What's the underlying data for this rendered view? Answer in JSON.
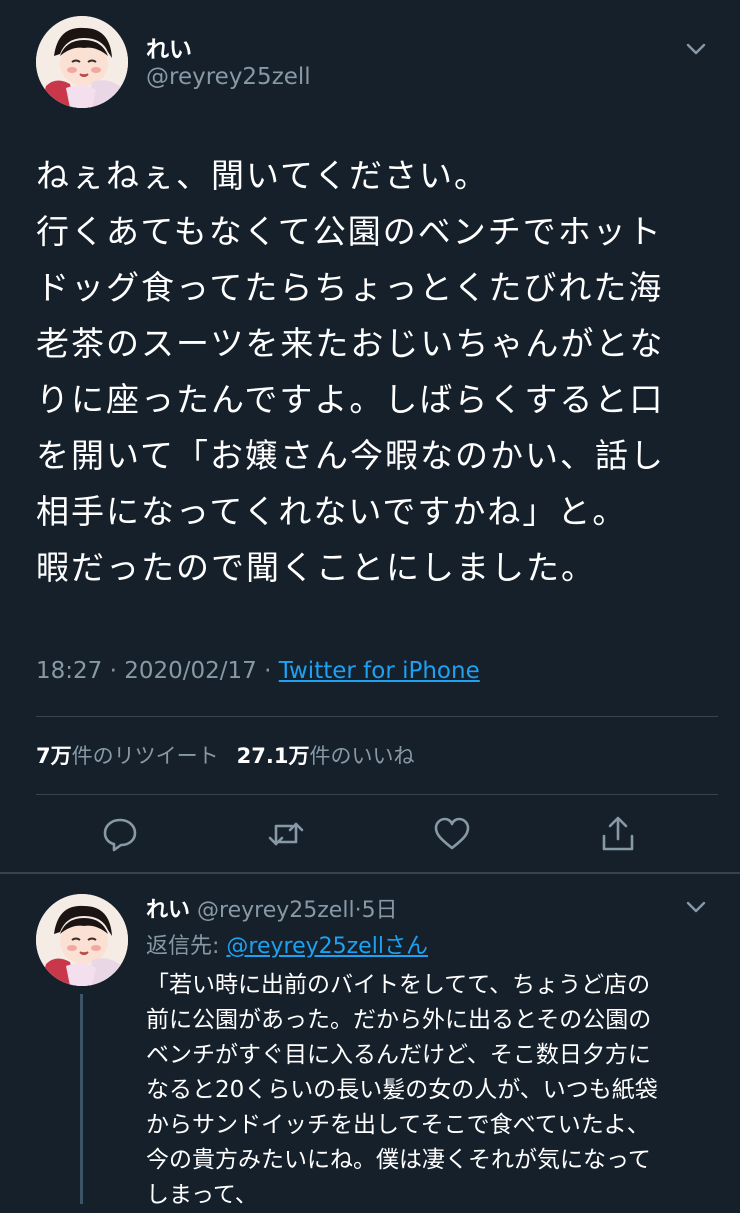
{
  "main_tweet": {
    "display_name": "れい",
    "handle": "@reyrey25zell",
    "text_lines": [
      "ねぇねぇ、聞いてください。",
      "行くあてもなくて公園のベンチでホット",
      "ドッグ食ってたらちょっとくたびれた海",
      "老茶のスーツを来たおじいちゃんがとな",
      "りに座ったんですよ。しばらくすると口",
      "を開いて「お嬢さん今暇なのかい、話し",
      "相手になってくれないですかね」と。",
      "暇だったので聞くことにしました。"
    ],
    "time": "18:27",
    "separator": "·",
    "date": "2020/02/17",
    "source": "Twitter for iPhone",
    "retweet_count": "7万",
    "retweet_label": "件のリツイート",
    "like_count": "27.1万",
    "like_label": "件のいいね",
    "icons": [
      "chevron-down-icon",
      "reply-icon",
      "retweet-icon",
      "like-icon",
      "share-icon"
    ]
  },
  "reply_tweet": {
    "display_name": "れい",
    "handle": "@reyrey25zell",
    "separator": "·",
    "age": "5日",
    "reply_to_label": "返信先: ",
    "reply_to_mention": "@reyrey25zellさん",
    "text_lines": [
      "「若い時に出前のバイトをしてて、ちょうど店の",
      "前に公園があった。だから外に出るとその公園の",
      "ベンチがすぐ目に入るんだけど、そこ数日夕方に",
      "なると20くらいの長い髪の女の人が、いつも紙袋",
      "からサンドイッチを出してそこで食べていたよ、",
      "今の貴方みたいにね。僕は凄くそれが気になって",
      "しまって、"
    ]
  },
  "colors": {
    "background": "#15202b",
    "text": "#ffffff",
    "secondary": "#8899a6",
    "accent": "#1da1f2",
    "divider": "#38444d"
  }
}
